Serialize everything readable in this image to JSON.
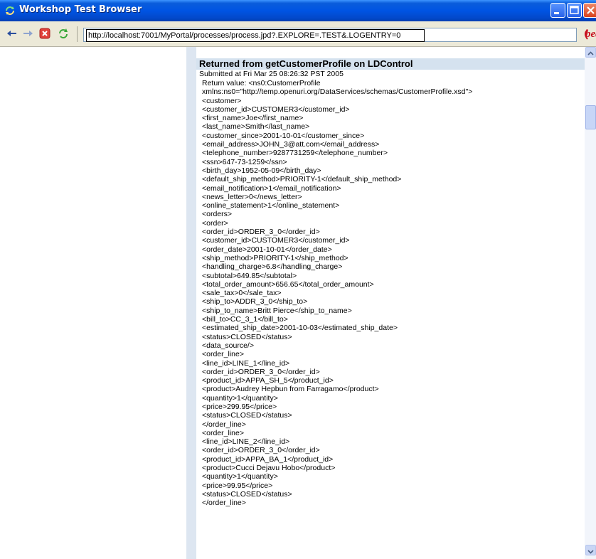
{
  "window": {
    "title": "Workshop Test Browser",
    "icon": "refresh-arrows-icon"
  },
  "window_controls": [
    "minimize-icon",
    "maximize-icon",
    "close-icon"
  ],
  "nav": {
    "back_icon": "back-arrow-icon",
    "forward_icon": "forward-arrow-icon",
    "stop_icon": "stop-icon",
    "refresh_icon": "refresh-icon",
    "url": "http://localhost:7001/MyPortal/processes/process.jpd?.EXPLORE=.TEST&.LOGENTRY=0",
    "logo_text": "bea"
  },
  "result": {
    "title": "Returned from getCustomerProfile on LDControl",
    "submitted": "Submitted at Fri Mar 25 08:26:32 PST 2005",
    "lines": [
      "Return value: <ns0:CustomerProfile",
      "xmlns:ns0=\"http://temp.openuri.org/DataServices/schemas/CustomerProfile.xsd\">",
      "<customer>",
      "<customer_id>CUSTOMER3</customer_id>",
      "<first_name>Joe</first_name>",
      "<last_name>Smith</last_name>",
      "<customer_since>2001-10-01</customer_since>",
      "<email_address>JOHN_3@att.com</email_address>",
      "<telephone_number>9287731259</telephone_number>",
      "<ssn>647-73-1259</ssn>",
      "<birth_day>1952-05-09</birth_day>",
      "<default_ship_method>PRIORITY-1</default_ship_method>",
      "<email_notification>1</email_notification>",
      "<news_letter>0</news_letter>",
      "<online_statement>1</online_statement>",
      "<orders>",
      "<order>",
      "<order_id>ORDER_3_0</order_id>",
      "<customer_id>CUSTOMER3</customer_id>",
      "<order_date>2001-10-01</order_date>",
      "<ship_method>PRIORITY-1</ship_method>",
      "<handling_charge>6.8</handling_charge>",
      "<subtotal>649.85</subtotal>",
      "<total_order_amount>656.65</total_order_amount>",
      "<sale_tax>0</sale_tax>",
      "<ship_to>ADDR_3_0</ship_to>",
      "<ship_to_name>Britt Pierce</ship_to_name>",
      "<bill_to>CC_3_1</bill_to>",
      "<estimated_ship_date>2001-10-03</estimated_ship_date>",
      "<status>CLOSED</status>",
      "<data_source/>",
      "<order_line>",
      "<line_id>LINE_1</line_id>",
      "<order_id>ORDER_3_0</order_id>",
      "<product_id>APPA_SH_5</product_id>",
      "<product>Audrey Hepbun from Farragamo</product>",
      "<quantity>1</quantity>",
      "<price>299.95</price>",
      "<status>CLOSED</status>",
      "</order_line>",
      "<order_line>",
      "<line_id>LINE_2</line_id>",
      "<order_id>ORDER_3_0</order_id>",
      "<product_id>APPA_BA_1</product_id>",
      "<product>Cucci Dejavu Hobo</product>",
      "<quantity>1</quantity>",
      "<price>99.95</price>",
      "<status>CLOSED</status>",
      "</order_line>"
    ]
  },
  "scrollbar": {
    "up_icon": "scroll-up-arrow-icon",
    "down_icon": "scroll-down-arrow-icon"
  }
}
